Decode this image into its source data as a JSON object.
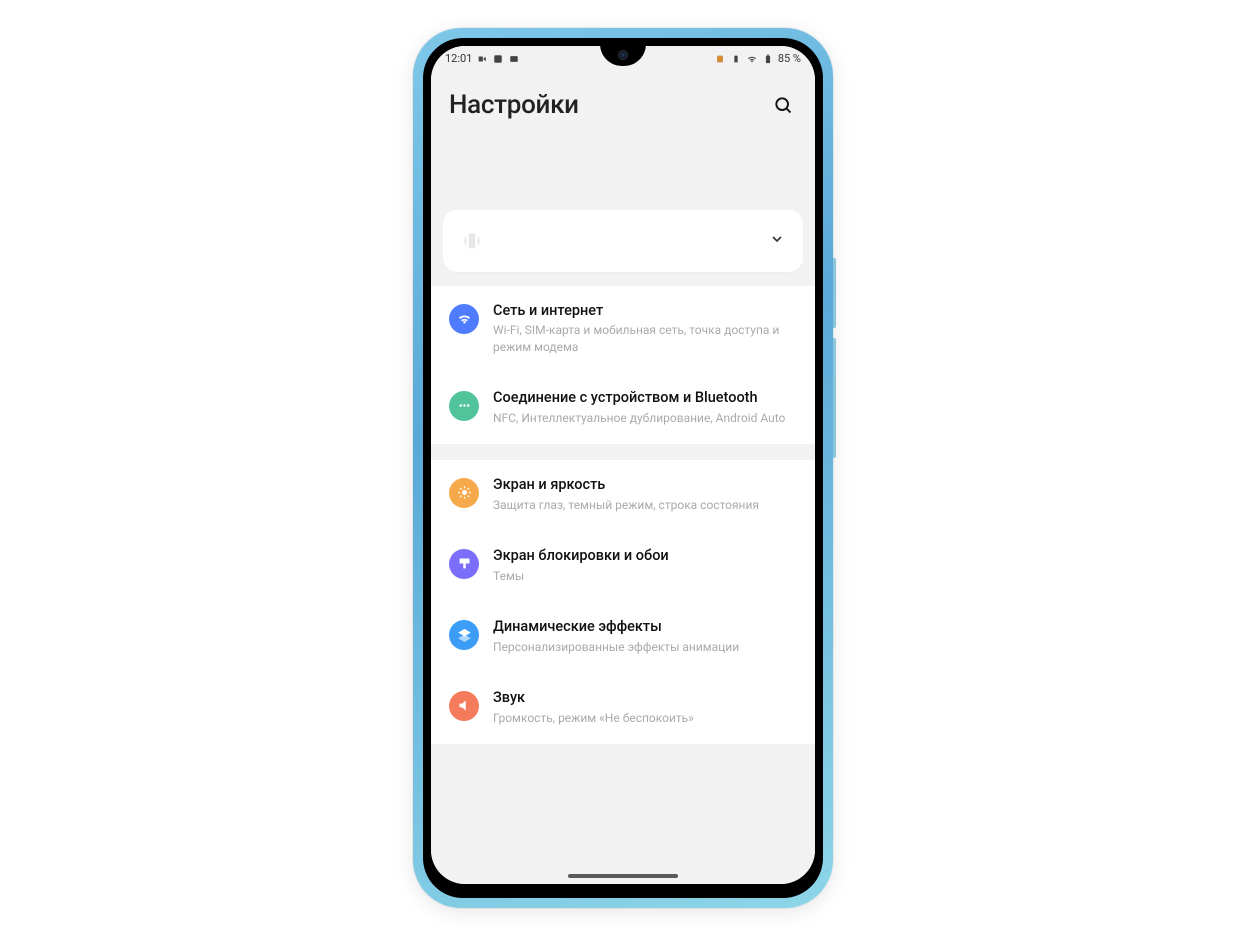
{
  "status": {
    "time": "12:01",
    "battery": "85 %"
  },
  "header": {
    "title": "Настройки"
  },
  "sections": [
    {
      "items": [
        {
          "icon": "wifi",
          "color": "ic-blue",
          "title": "Сеть и интернет",
          "sub": "Wi-Fi, SIM-карта и мобильная сеть, точка доступа и режим модема"
        },
        {
          "icon": "dots",
          "color": "ic-green",
          "title": "Соединение с устройством и Bluetooth",
          "sub": "NFC, Интеллектуальное дублирование, Android Auto"
        }
      ]
    },
    {
      "items": [
        {
          "icon": "sun",
          "color": "ic-orange",
          "title": "Экран и яркость",
          "sub": "Защита глаз, темный режим, строка состояния"
        },
        {
          "icon": "brush",
          "color": "ic-purple",
          "title": "Экран блокировки и обои",
          "sub": "Темы"
        },
        {
          "icon": "layers",
          "color": "ic-sky",
          "title": "Динамические эффекты",
          "sub": "Персонализированные эффекты анимации"
        },
        {
          "icon": "sound",
          "color": "ic-coral",
          "title": "Звук",
          "sub": "Громкость, режим «Не беспокоить»"
        }
      ]
    }
  ]
}
